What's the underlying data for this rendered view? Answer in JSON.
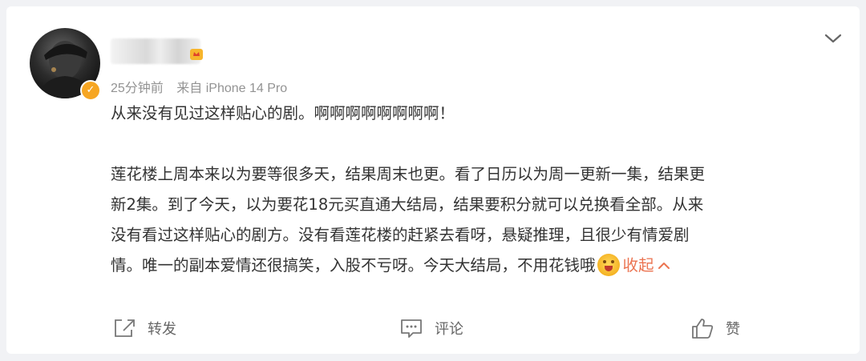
{
  "post": {
    "time": "25分钟前",
    "source": "来自 iPhone 14 Pro",
    "paragraph1": "从来没有见过这样贴心的剧。啊啊啊啊啊啊啊啊！",
    "paragraph2_lines": [
      "莲花楼上周本来以为要等很多天，结果周末也更。看了日历以为周一更新一集，结果更",
      "新2集。到了今天，以为要花18元买直通大结局，结果要积分就可以兑换看全部。从来",
      "没有看过这样贴心的剧方。没有看莲花楼的赶紧去看呀，悬疑推理，且很少有情爱剧",
      "情。唯一的副本爱情还很搞笑，入股不亏呀。今天大结局，不用花钱哦"
    ],
    "emoji": "face-with-open-mouth-emoji",
    "collapse_label": "收起",
    "collapse_arrow": "^"
  },
  "actions": {
    "repost": "转发",
    "comment": "评论",
    "like": "赞"
  },
  "colors": {
    "link": "#eb7350",
    "text": "#333333",
    "meta": "#939393",
    "verified": "#f6a623"
  },
  "icons": {
    "menu": "chevron-down-icon",
    "repost": "repost-icon",
    "comment": "comment-icon",
    "like": "thumbs-up-icon",
    "badge": "crown-icon"
  }
}
